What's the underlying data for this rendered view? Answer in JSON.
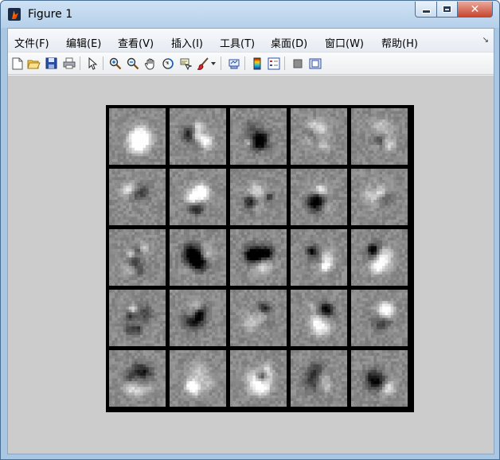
{
  "window": {
    "title": "Figure 1",
    "close_glyph": "✕"
  },
  "menubar": {
    "items": [
      {
        "label": "文件(F)",
        "name": "menu-file"
      },
      {
        "label": "编辑(E)",
        "name": "menu-edit"
      },
      {
        "label": "查看(V)",
        "name": "menu-view"
      },
      {
        "label": "插入(I)",
        "name": "menu-insert"
      },
      {
        "label": "工具(T)",
        "name": "menu-tools"
      },
      {
        "label": "桌面(D)",
        "name": "menu-desktop"
      },
      {
        "label": "窗口(W)",
        "name": "menu-window"
      },
      {
        "label": "帮助(H)",
        "name": "menu-help"
      }
    ],
    "overflow_glyph": "↘"
  },
  "toolbar": {
    "icons": [
      "new-figure-icon",
      "open-file-icon",
      "save-icon",
      "print-icon",
      "select-arrow-icon",
      "zoom-in-icon",
      "zoom-out-icon",
      "pan-hand-icon",
      "rotate-3d-icon",
      "data-cursor-icon",
      "brush-icon",
      "brush-dropdown-icon",
      "link-plot-icon",
      "colorbar-icon",
      "legend-icon",
      "hide-plot-tools-icon",
      "show-plot-tools-icon"
    ]
  },
  "colors": {
    "figure_background": "#cccccc",
    "tile_gray": "#8a8a8a",
    "grid_border": "#000000"
  },
  "image_grid": {
    "rows": 5,
    "cols": 5
  }
}
